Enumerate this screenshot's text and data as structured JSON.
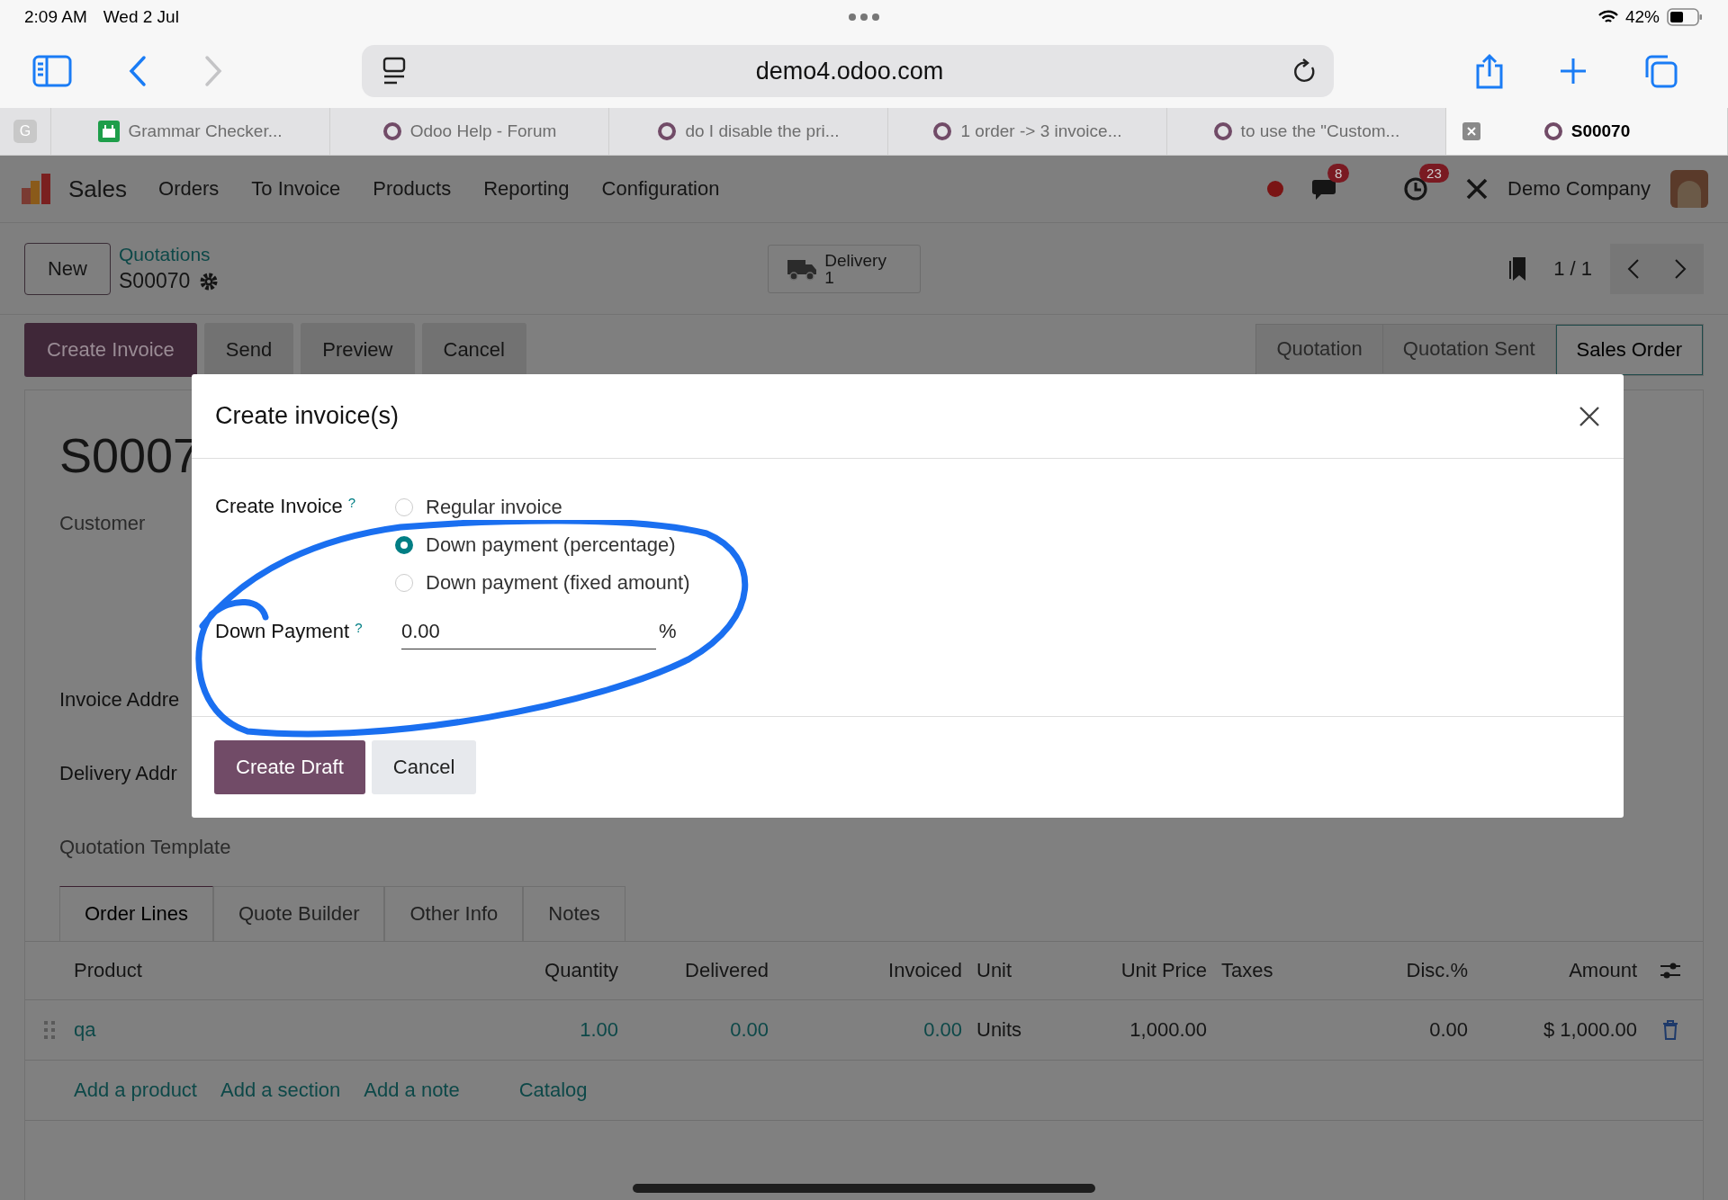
{
  "status_bar": {
    "time": "2:09 AM",
    "date": "Wed 2 Jul",
    "battery": "42%"
  },
  "browser": {
    "url": "demo4.odoo.com",
    "tabs": [
      {
        "kind": "pinned",
        "letter": "G",
        "selected": false
      },
      {
        "kind": "sheet",
        "title": "Grammar Checker...",
        "selected": false
      },
      {
        "kind": "odoo",
        "title": "Odoo Help - Forum",
        "selected": false
      },
      {
        "kind": "odoo",
        "title": "do I disable the pri...",
        "selected": false
      },
      {
        "kind": "odoo",
        "title": "1 order -> 3 invoice...",
        "selected": false
      },
      {
        "kind": "odoo",
        "title": "to use the \"Custom...",
        "selected": false
      },
      {
        "kind": "odoo",
        "title": "S00070",
        "selected": true
      }
    ]
  },
  "app": {
    "name": "Sales",
    "menu": [
      "Orders",
      "To Invoice",
      "Products",
      "Reporting",
      "Configuration"
    ],
    "messages_badge": "8",
    "activities_badge": "23",
    "company": "Demo Company"
  },
  "control_panel": {
    "new_button": "New",
    "breadcrumb": "Quotations",
    "record": "S00070",
    "smart_button": {
      "label": "Delivery",
      "count": "1"
    },
    "pager": "1 / 1"
  },
  "actions": [
    {
      "label": "Create Invoice",
      "primary": true
    },
    {
      "label": "Send",
      "primary": false
    },
    {
      "label": "Preview",
      "primary": false
    },
    {
      "label": "Cancel",
      "primary": false
    }
  ],
  "stages": [
    {
      "label": "Quotation",
      "selected": false
    },
    {
      "label": "Quotation Sent",
      "selected": false
    },
    {
      "label": "Sales Order",
      "selected": true
    }
  ],
  "form": {
    "title": "S0007",
    "fields": [
      "Customer",
      "Invoice Addre",
      "Delivery Addr",
      "Quotation Template"
    ],
    "tabs": [
      {
        "label": "Order Lines",
        "selected": true
      },
      {
        "label": "Quote Builder",
        "selected": false
      },
      {
        "label": "Other Info",
        "selected": false
      },
      {
        "label": "Notes",
        "selected": false
      }
    ],
    "table": {
      "columns": [
        "Product",
        "Quantity",
        "Delivered",
        "Invoiced",
        "Unit",
        "Unit Price",
        "Taxes",
        "Disc.%",
        "Amount"
      ],
      "rows": [
        {
          "product": "qa",
          "quantity": "1.00",
          "delivered": "0.00",
          "invoiced": "0.00",
          "unit": "Units",
          "unit_price": "1,000.00",
          "discount": "0.00",
          "amount": "$ 1,000.00"
        }
      ],
      "add_links": [
        "Add a product",
        "Add a section",
        "Add a note",
        "Catalog"
      ]
    }
  },
  "dialog": {
    "title": "Create invoice(s)",
    "field_label": "Create Invoice",
    "field_help": "?",
    "options": [
      {
        "label": "Regular invoice",
        "selected": false
      },
      {
        "label": "Down payment (percentage)",
        "selected": true
      },
      {
        "label": "Down payment (fixed amount)",
        "selected": false
      }
    ],
    "amount_label": "Down Payment",
    "amount_help": "?",
    "amount_value": "0.00",
    "unit": "%",
    "buttons": [
      {
        "label": "Create Draft",
        "primary": true
      },
      {
        "label": "Cancel",
        "primary": false
      }
    ]
  }
}
